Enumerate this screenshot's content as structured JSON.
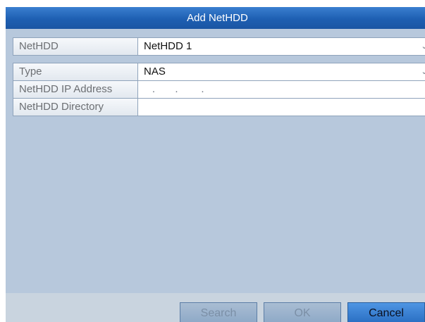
{
  "dialog": {
    "title": "Add NetHDD"
  },
  "fields": {
    "nethdd": {
      "label": "NetHDD",
      "value": "NetHDD 1"
    },
    "type": {
      "label": "Type",
      "value": "NAS"
    },
    "ip": {
      "label": "NetHDD IP Address",
      "value": ""
    },
    "directory": {
      "label": "NetHDD Directory",
      "value": ""
    }
  },
  "buttons": {
    "search": "Search",
    "ok": "OK",
    "cancel": "Cancel"
  },
  "icons": {
    "dropdown": "chevron-down-icon"
  },
  "colors": {
    "title_bar": "#1e5fb2",
    "dialog_bg": "#b7c8dc",
    "active_button": "#2a6fc3"
  }
}
